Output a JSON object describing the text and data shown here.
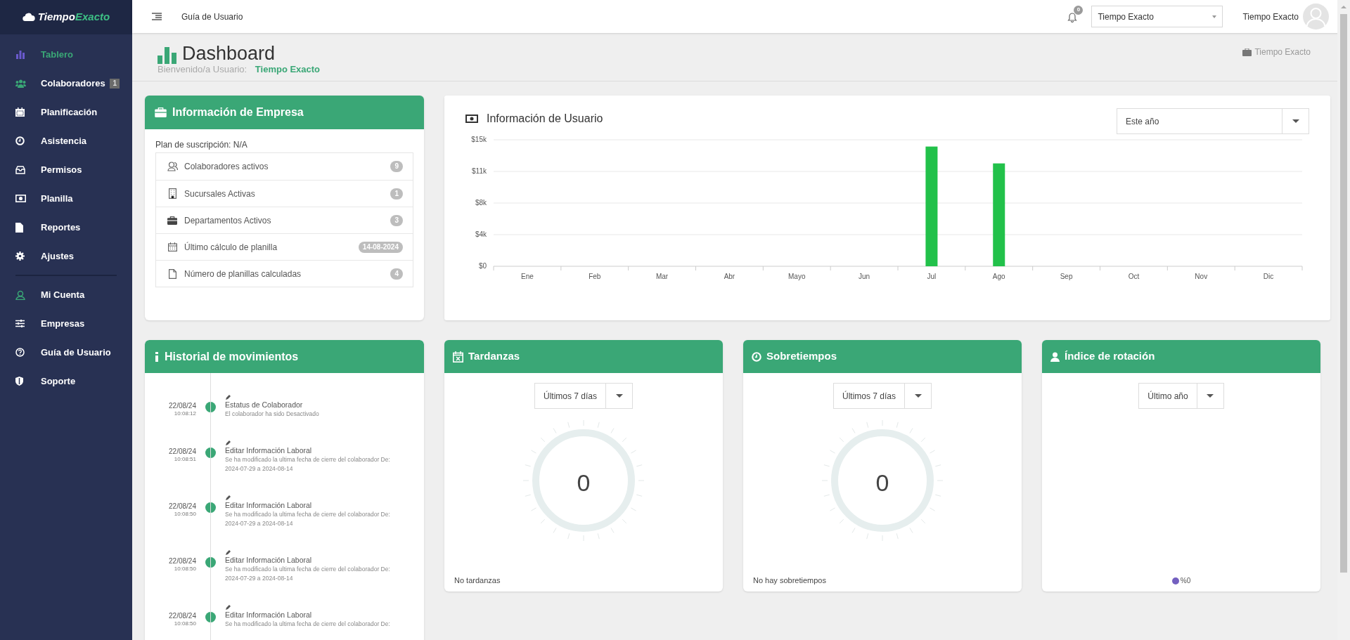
{
  "brand": {
    "part_1": "Tiempo",
    "part_2": "Exacto"
  },
  "sidebar": {
    "groups": [
      [
        {
          "label": "Tablero",
          "selected": true
        },
        {
          "label": "Colaboradores",
          "selected": false,
          "badge": "1"
        },
        {
          "label": "Planificación",
          "selected": false
        },
        {
          "label": "Asistencia",
          "selected": false
        },
        {
          "label": "Permisos",
          "selected": false
        },
        {
          "label": "Planilla",
          "selected": false
        },
        {
          "label": "Reportes",
          "selected": false
        },
        {
          "label": "Ajustes",
          "selected": false
        }
      ],
      [
        {
          "label": "Mi Cuenta",
          "selected": false
        },
        {
          "label": "Empresas",
          "selected": false
        },
        {
          "label": "Guía de Usuario",
          "selected": false
        },
        {
          "label": "Soporte",
          "selected": false
        }
      ]
    ]
  },
  "topbar": {
    "link": "Guía de Usuario",
    "notifications": "0",
    "company_select": "Tiempo Exacto",
    "user_name": "Tiempo Exacto"
  },
  "header": {
    "title": "Dashboard",
    "welcome": "Bienvenido/a Usuario:",
    "user": "Tiempo Exacto",
    "breadcrumb": "Tiempo Exacto"
  },
  "company_info": {
    "title": "Información de Empresa",
    "plan": "Plan de suscripción: N/A",
    "rows": [
      {
        "label": "Colaboradores activos",
        "count": "9"
      },
      {
        "label": "Sucursales Activas",
        "count": "1"
      },
      {
        "label": "Departamentos Activos",
        "count": "3"
      },
      {
        "label": "Último cálculo de planilla",
        "count": "14-08-2024"
      },
      {
        "label": "Número de planillas calculadas",
        "count": "4"
      }
    ]
  },
  "user_info": {
    "title": "Información de Usuario",
    "period": "Este año",
    "chart_data": {
      "type": "bar",
      "categories": [
        "Ene",
        "Feb",
        "Mar",
        "Abr",
        "Mayo",
        "Jun",
        "Jul",
        "Ago",
        "Sep",
        "Oct",
        "Nov",
        "Dic"
      ],
      "grid": true,
      "series": [
        {
          "color": "#22c14a",
          "values": [
            0,
            0,
            0,
            0,
            0,
            0,
            14200,
            12200,
            0,
            0,
            0,
            0
          ]
        }
      ],
      "ylim": [
        0,
        15000
      ],
      "yticks": [
        {
          "value": 0,
          "label": "$0"
        },
        {
          "value": 3750,
          "label": "$4k"
        },
        {
          "value": 7500,
          "label": "$8k"
        },
        {
          "value": 11250,
          "label": "$11k"
        },
        {
          "value": 15000,
          "label": "$15k"
        }
      ]
    }
  },
  "history": {
    "title": "Historial de movimientos",
    "entries": [
      {
        "date": "22/08/24",
        "time": "10:08:12",
        "title": "Estatus de Colaborador",
        "detail": "El colaborador ha sido Desactivado"
      },
      {
        "date": "22/08/24",
        "time": "10:08:51",
        "title": "Editar Información Laboral",
        "detail": "Se ha modificado la ultima fecha de cierre del colaborador De: 2024-07-29 a 2024-08-14"
      },
      {
        "date": "22/08/24",
        "time": "10:08:50",
        "title": "Editar Información Laboral",
        "detail": "Se ha modificado la ultima fecha de cierre del colaborador De: 2024-07-29 a 2024-08-14"
      },
      {
        "date": "22/08/24",
        "time": "10:08:50",
        "title": "Editar Información Laboral",
        "detail": "Se ha modificado la ultima fecha de cierre del colaborador De: 2024-07-29 a 2024-08-14"
      },
      {
        "date": "22/08/24",
        "time": "10:08:50",
        "title": "Editar Información Laboral",
        "detail": "Se ha modificado la ultima fecha de cierre del colaborador De:"
      }
    ]
  },
  "gauges": [
    {
      "title": "Tardanzas",
      "period": "Últimos 7 días",
      "value": "0",
      "footer": "No tardanzas"
    },
    {
      "title": "Sobretiempos",
      "period": "Últimos 7 días",
      "value": "0",
      "footer": "No hay sobretiempos"
    }
  ],
  "rotation": {
    "title": "Índice de rotación",
    "period": "Último año",
    "legend": "%0"
  }
}
